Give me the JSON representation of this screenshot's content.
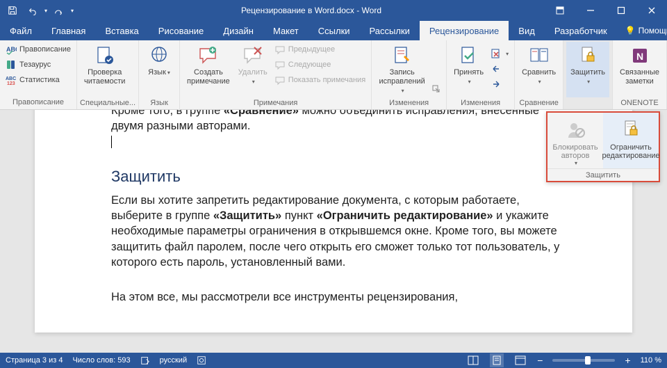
{
  "title": "Рецензирование в Word.docx  -  Word",
  "qat": {
    "save_tip": "Сохранить",
    "undo_tip": "Отменить",
    "redo_tip": "Повторить"
  },
  "tabs": [
    "Файл",
    "Главная",
    "Вставка",
    "Рисование",
    "Дизайн",
    "Макет",
    "Ссылки",
    "Рассылки",
    "Рецензирование",
    "Вид",
    "Разработчик"
  ],
  "active_tab_index": 8,
  "help_label": "Помощн...",
  "ribbon": {
    "proofing": {
      "spelling": "Правописание",
      "thesaurus": "Тезаурус",
      "statistics": "Статистика",
      "caption": "Правописание"
    },
    "accessibility": {
      "readability": "Проверка\nчитаемости",
      "caption": "Специальные..."
    },
    "language": {
      "label": "Язык",
      "caption": "Язык"
    },
    "comments": {
      "new": "Создать\nпримечание",
      "delete": "Удалить",
      "previous": "Предыдущее",
      "next": "Следующее",
      "show": "Показать примечания",
      "caption": "Примечания"
    },
    "tracking": {
      "track": "Запись\nисправлений",
      "caption": "Изменения"
    },
    "changes": {
      "accept": "Принять",
      "caption": "Изменения"
    },
    "compare": {
      "label": "Сравнить",
      "caption": "Сравнение"
    },
    "protect": {
      "label": "Защитить",
      "caption": ""
    },
    "onenote": {
      "label": "Связанные\nзаметки",
      "caption": "ONENOTE"
    }
  },
  "protect_popup": {
    "block_authors": "Блокировать\nавторов",
    "restrict": "Ограничить\nредактирование",
    "caption": "Защитить"
  },
  "document": {
    "p1_a": "Кроме того, в группе ",
    "p1_b": "«Сравнение»",
    "p1_c": " можно объединить исправления, внесенные двумя разными авторами.",
    "h3": "Защитить",
    "p2_a": "Если вы хотите запретить редактирование документа, с которым работаете, выберите в группе ",
    "p2_b": "«Защитить»",
    "p2_c": " пункт ",
    "p2_d": "«Ограничить редактирование»",
    "p2_e": " и укажите необходимые параметры ограничения в открывшемся окне. Кроме того, вы можете защитить файл паролем, после чего открыть его сможет только тот пользователь, у которого есть пароль, установленный вами.",
    "p3": "На этом все, мы рассмотрели все инструменты рецензирования,"
  },
  "status": {
    "page": "Страница 3 из 4",
    "words": "Число слов: 593",
    "lang": "русский",
    "zoom": "110 %"
  }
}
